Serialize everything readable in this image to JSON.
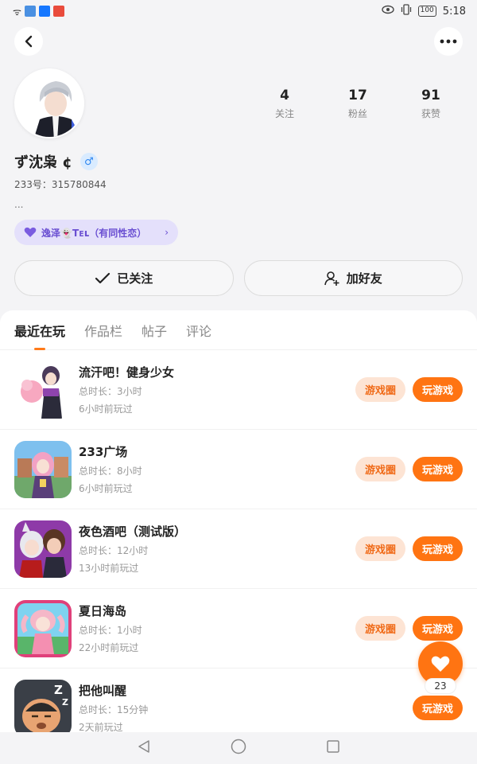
{
  "status": {
    "time": "5:18",
    "battery": "100"
  },
  "profile": {
    "username": "ず沈枭 ¢",
    "gender_symbol": "♂",
    "id_line": "233号：315780844",
    "bio": "...",
    "relation": "逸泽👻Tᴇʟ（有同性恋）"
  },
  "stats": [
    {
      "num": "4",
      "label": "关注"
    },
    {
      "num": "17",
      "label": "粉丝"
    },
    {
      "num": "91",
      "label": "获赞"
    }
  ],
  "actions": {
    "follow": "已关注",
    "add_friend": "加好友"
  },
  "tabs": [
    "最近在玩",
    "作品栏",
    "帖子",
    "评论"
  ],
  "games": [
    {
      "name": "流汗吧！健身少女",
      "duration": "总时长：3小时",
      "last": "6小时前玩过",
      "circle": "游戏圈",
      "play": "玩游戏"
    },
    {
      "name": "233广场",
      "duration": "总时长：8小时",
      "last": "6小时前玩过",
      "circle": "游戏圈",
      "play": "玩游戏"
    },
    {
      "name": "夜色酒吧（测试版）",
      "duration": "总时长：12小时",
      "last": "13小时前玩过",
      "circle": "游戏圈",
      "play": "玩游戏"
    },
    {
      "name": "夏日海岛",
      "duration": "总时长：1小时",
      "last": "22小时前玩过",
      "circle": "游戏圈",
      "play": "玩游戏"
    },
    {
      "name": "把他叫醒",
      "duration": "总时长：15分钟",
      "last": "2天前玩过",
      "play": "玩游戏"
    }
  ],
  "fav_count": "23",
  "colors": {
    "accent": "#ff7412",
    "accent_light": "#fde4d4",
    "relation": "#6a4fd2"
  }
}
